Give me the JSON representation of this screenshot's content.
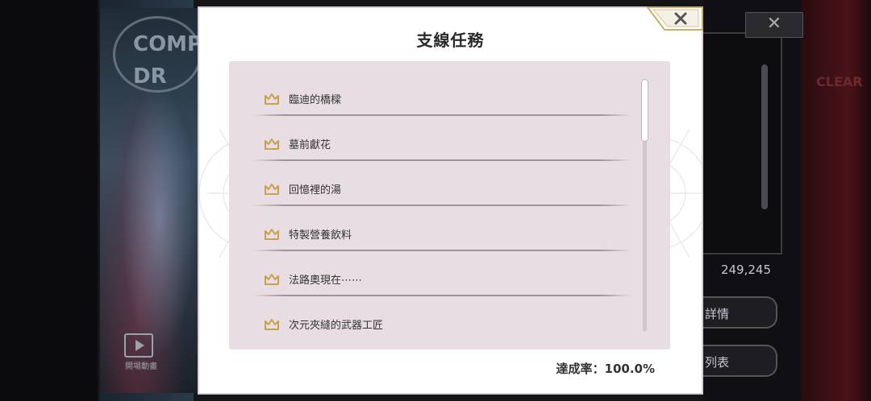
{
  "background": {
    "logo_text": "COMP DR",
    "video_label": "開場動畫",
    "score": "249,245",
    "button1_label": "詳情",
    "button2_label": "列表",
    "clear_text": "CLEAR",
    "close_symbol": "✕"
  },
  "dialog": {
    "title": "支線任務",
    "close_icon": "close-icon",
    "items": [
      {
        "icon": "crown-icon",
        "label": "臨迪的橋樑"
      },
      {
        "icon": "crown-icon",
        "label": "墓前獻花"
      },
      {
        "icon": "crown-icon",
        "label": "回憶裡的湯"
      },
      {
        "icon": "crown-icon",
        "label": "特製營養飲料"
      },
      {
        "icon": "crown-icon",
        "label": "法路奧現在⋯⋯"
      },
      {
        "icon": "crown-icon",
        "label": "次元夾縫的武器工匠"
      }
    ],
    "completion_label": "達成率：",
    "completion_value": "100.0%"
  },
  "colors": {
    "panel_bg": "#e7dde2",
    "crown": "#c8a24a",
    "close_border": "#c9b06a"
  }
}
